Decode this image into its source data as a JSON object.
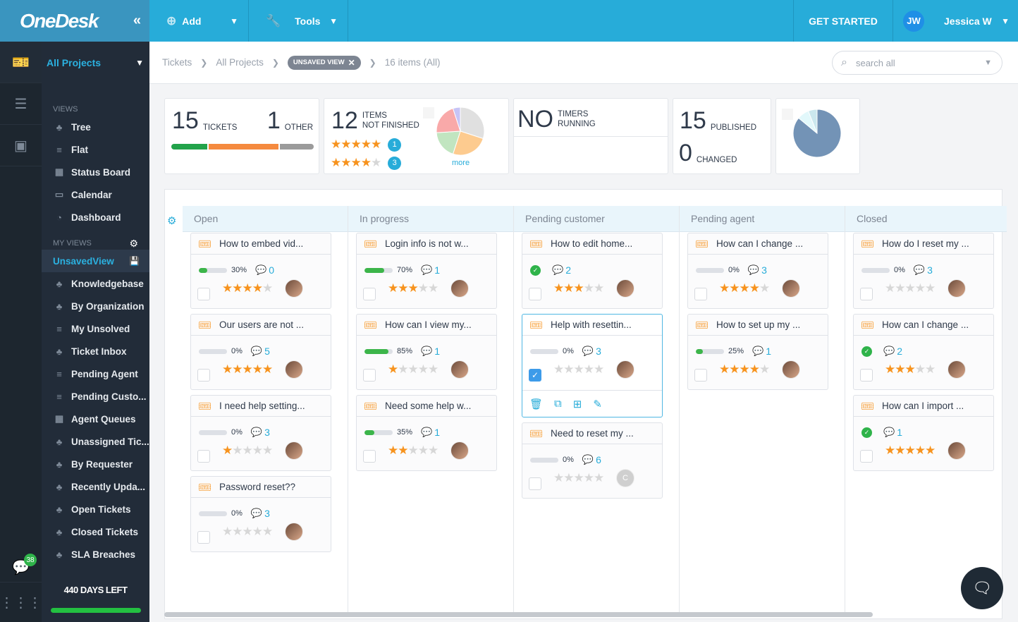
{
  "topbar": {
    "logo": "OneDesk",
    "collapse_icon": "«",
    "add_label": "Add",
    "tools_label": "Tools",
    "get_started": "GET STARTED",
    "user_initials": "JW",
    "user_name": "Jessica W"
  },
  "rail": {
    "chat_badge": "38"
  },
  "sidebar": {
    "project": "All Projects",
    "views_label": "VIEWS",
    "views": [
      {
        "label": "Tree",
        "icon": "tree"
      },
      {
        "label": "Flat",
        "icon": "flat"
      },
      {
        "label": "Status Board",
        "icon": "grid"
      },
      {
        "label": "Calendar",
        "icon": "calendar"
      },
      {
        "label": "Dashboard",
        "icon": "pie"
      }
    ],
    "my_views_label": "MY VIEWS",
    "my_views": [
      {
        "label": "UnsavedView",
        "icon": "",
        "active": true
      },
      {
        "label": "Knowledgebase",
        "icon": "tree"
      },
      {
        "label": "By Organization",
        "icon": "tree"
      },
      {
        "label": "My Unsolved",
        "icon": "flat"
      },
      {
        "label": "Ticket Inbox",
        "icon": "tree"
      },
      {
        "label": "Pending Agent",
        "icon": "flat"
      },
      {
        "label": "Pending Custo...",
        "icon": "flat"
      },
      {
        "label": "Agent Queues",
        "icon": "grid"
      },
      {
        "label": "Unassigned Tic...",
        "icon": "tree"
      },
      {
        "label": "By Requester",
        "icon": "tree"
      },
      {
        "label": "Recently Upda...",
        "icon": "tree"
      },
      {
        "label": "Open Tickets",
        "icon": "tree"
      },
      {
        "label": "Closed Tickets",
        "icon": "tree"
      },
      {
        "label": "SLA Breaches",
        "icon": "tree"
      }
    ],
    "days_left": "440 DAYS LEFT",
    "days_progress": 1.0
  },
  "header": {
    "crumb1": "Tickets",
    "crumb2": "All Projects",
    "view_tag": "UNSAVED VIEW",
    "item_count": "16 items (All)",
    "search_placeholder": "search all"
  },
  "stats": {
    "tickets_num": "15",
    "tickets_label": "TICKETS",
    "other_num": "1",
    "other_label": "OTHER",
    "mix": [
      {
        "color": "#22a34a",
        "fraction": 0.25
      },
      {
        "color": "#f58a3f",
        "fraction": 0.5
      },
      {
        "color": "#9b9b9b",
        "fraction": 0.25
      }
    ],
    "items_num": "12",
    "items_label1": "ITEMS",
    "items_label2": "NOT FINISHED",
    "rating_rows": [
      {
        "stars": 5,
        "count": "1"
      },
      {
        "stars": 4,
        "count": "3"
      }
    ],
    "more": "more",
    "timers_num": "NO",
    "timers_label1": "TIMERS",
    "timers_label2": "RUNNING",
    "published_num": "15",
    "published_label": "PUBLISHED",
    "changed_num": "0",
    "changed_label": "CHANGED"
  },
  "board": {
    "columns": [
      {
        "title": "Open",
        "cards": [
          {
            "title": "How to embed vid...",
            "progress": 30,
            "done": false,
            "comments": "0",
            "stars": 4,
            "avatar": "single"
          },
          {
            "title": "Our users are not ...",
            "progress": 0,
            "done": false,
            "comments": "5",
            "stars": 5,
            "avatar": "single"
          },
          {
            "title": "I need help setting...",
            "progress": 0,
            "done": false,
            "comments": "3",
            "stars": 1,
            "avatar": "single"
          },
          {
            "title": "Password reset??",
            "progress": 0,
            "done": false,
            "comments": "3",
            "stars": 0,
            "avatar": "two"
          }
        ]
      },
      {
        "title": "In progress",
        "cards": [
          {
            "title": "Login info is not w...",
            "progress": 70,
            "done": false,
            "comments": "1",
            "stars": 3,
            "avatar": "single"
          },
          {
            "title": "How can I view my...",
            "progress": 85,
            "done": false,
            "comments": "1",
            "stars": 1,
            "avatar": "single"
          },
          {
            "title": "Need some help w...",
            "progress": 35,
            "done": false,
            "comments": "1",
            "stars": 2,
            "avatar": "single"
          }
        ]
      },
      {
        "title": "Pending customer",
        "cards": [
          {
            "title": "How to edit home...",
            "progress": null,
            "done": true,
            "comments": "2",
            "stars": 3,
            "avatar": "single"
          },
          {
            "title": "Help with resettin...",
            "progress": 0,
            "done": false,
            "comments": "3",
            "stars": 0,
            "avatar": "two",
            "selected": true
          },
          {
            "title": "Need to reset my ...",
            "progress": 0,
            "done": false,
            "comments": "6",
            "stars": 0,
            "avatar": "letter",
            "letter": "C"
          }
        ]
      },
      {
        "title": "Pending agent",
        "cards": [
          {
            "title": "How can I change ...",
            "progress": 0,
            "done": false,
            "comments": "3",
            "stars": 4,
            "avatar": "single"
          },
          {
            "title": "How to set up my ...",
            "progress": 25,
            "done": false,
            "comments": "1",
            "stars": 4,
            "avatar": "single"
          }
        ]
      },
      {
        "title": "Closed",
        "cards": [
          {
            "title": "How do I reset my ...",
            "progress": 0,
            "done": false,
            "comments": "3",
            "stars": 0,
            "avatar": "two"
          },
          {
            "title": "How can I change ...",
            "progress": null,
            "done": true,
            "comments": "2",
            "stars": 3,
            "avatar": "single"
          },
          {
            "title": "How can I import ...",
            "progress": null,
            "done": true,
            "comments": "1",
            "stars": 5,
            "avatar": "single"
          }
        ]
      }
    ]
  },
  "pie1": [
    {
      "color": "#e0e0e0",
      "value": 30
    },
    {
      "color": "#fdcb8f",
      "value": 25
    },
    {
      "color": "#c1e5c0",
      "value": 19
    },
    {
      "color": "#f9a9a9",
      "value": 21
    },
    {
      "color": "#c7c4f6",
      "value": 5
    }
  ],
  "pie2": [
    {
      "color": "#7393b6",
      "value": 86
    },
    {
      "color": "#e2f8fb",
      "value": 8
    },
    {
      "color": "#cbe8ee",
      "value": 6
    }
  ]
}
